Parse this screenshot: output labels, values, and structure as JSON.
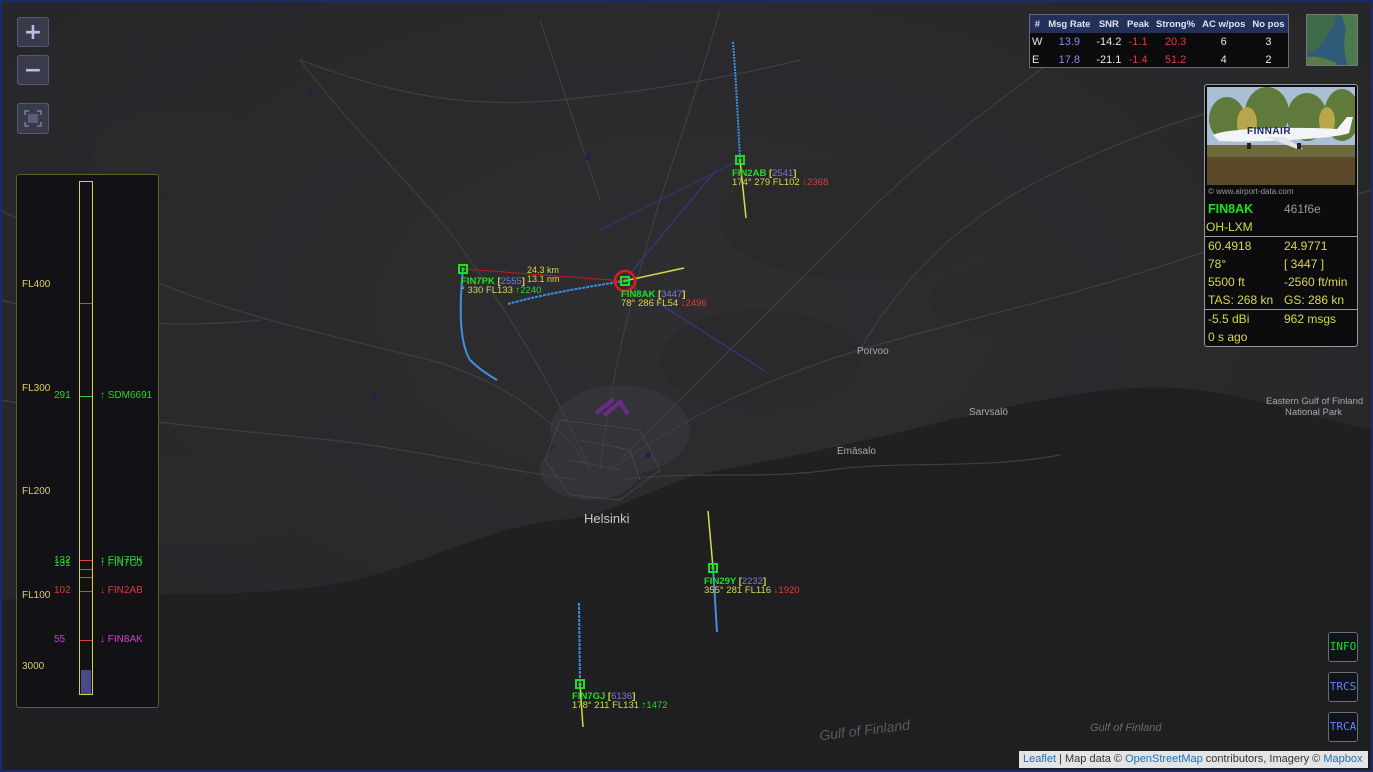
{
  "zoom": {
    "in_label": "+",
    "out_label": "−"
  },
  "stats": {
    "headers": [
      "#",
      "Msg Rate",
      "SNR",
      "Peak",
      "Strong%",
      "AC w/pos",
      "No pos"
    ],
    "rows": [
      {
        "id": "W",
        "msg_rate": "13.9",
        "snr": "-14.2",
        "peak": "-1.1",
        "strong": "20.3",
        "ac_pos": "6",
        "no_pos": "3"
      },
      {
        "id": "E",
        "msg_rate": "17.8",
        "snr": "-21.1",
        "peak": "-1.4",
        "strong": "51.2",
        "ac_pos": "4",
        "no_pos": "2"
      }
    ]
  },
  "infobox": {
    "photo_credit": "© www.airport-data.com",
    "callsign": "FIN8AK",
    "hex": "461f6e",
    "registration": "OH-LXM",
    "lat": "60.4918",
    "lon": "24.9771",
    "track": "78°",
    "squawk": "[ 3447 ]",
    "altitude": "5500 ft",
    "vrate": "-2560 ft/min",
    "tas": "TAS: 268 kn",
    "gs": "GS: 286 kn",
    "rssi": "-5.5 dBi",
    "msgs": "962 msgs",
    "age": "0 s ago"
  },
  "altitude_panel": {
    "scale_labels": [
      "FL400",
      "FL300",
      "FL200",
      "FL100",
      "3000"
    ],
    "markers": [
      {
        "value": "291",
        "label": "↑ SDM6691",
        "color": "#2fd12f"
      },
      {
        "value": "132",
        "label": "↑ FIN7PK",
        "color": "#2fd12f"
      },
      {
        "value": "131",
        "label": "↑ FIN7GJ",
        "color": "#2fd12f"
      },
      {
        "value": "102",
        "label": "↓ FIN2AB",
        "color": "#e03a3a"
      },
      {
        "value": "55",
        "label": "↓ FIN8AK",
        "color": "#d040d0"
      }
    ]
  },
  "aircraft": [
    {
      "callsign": "FIN2AB",
      "squawk": "2541",
      "info": "174° 279 FL102",
      "vrate": "↓2368",
      "vcolor": "#e03a3a"
    },
    {
      "callsign": "FIN7PK",
      "squawk": "2555",
      "info": "° 330 FL133",
      "vrate": "↑2240",
      "vcolor": "#2fd12f"
    },
    {
      "callsign": "FIN8AK",
      "squawk": "3447",
      "info": "78° 286 FL54",
      "vrate": "↓2496",
      "vcolor": "#e03a3a"
    },
    {
      "callsign": "FIN29Y",
      "squawk": "2232",
      "info": "355° 281 FL116",
      "vrate": "↓1920",
      "vcolor": "#e03a3a"
    },
    {
      "callsign": "FIN7GJ",
      "squawk": "6136",
      "info": "178° 211 FL131",
      "vrate": "↑1472",
      "vcolor": "#2fd12f"
    }
  ],
  "range_label": {
    "distance": "24.3 km",
    "nm": "13.1 nm"
  },
  "map_labels": {
    "helsinki": "Helsinki",
    "porvoo": "Porvoo",
    "sarvsalo": "Sarvsalö",
    "emasalo": "Emäsalo",
    "eastern_gulf_1": "Eastern Gulf of Finland",
    "eastern_gulf_2": "National Park",
    "gulf_big": "Gulf of Finland",
    "gulf_small": "Gulf of Finland"
  },
  "side_buttons": [
    "INFO",
    "TRCS",
    "TRCA"
  ],
  "attribution": {
    "leaflet": "Leaflet",
    "sep": " | Map data © ",
    "osm": "OpenStreetMap",
    "mid": " contributors, Imagery © ",
    "mapbox": "Mapbox"
  },
  "colors": {
    "aircraft": "#22dd22",
    "label_yellow": "#d8d84a",
    "track_blue": "#3d8fe6",
    "selected_ring": "#e01a1a",
    "panel_bar": "#d9cf3a"
  }
}
